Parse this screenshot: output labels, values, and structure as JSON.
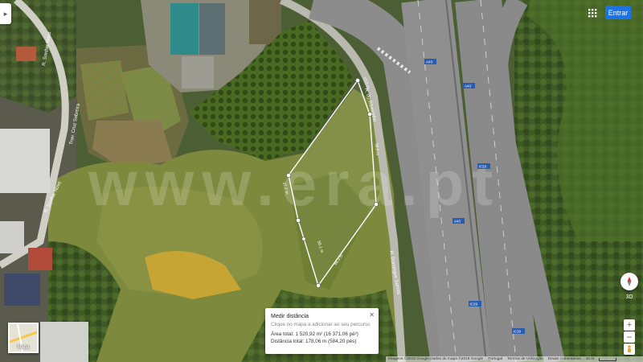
{
  "map": {
    "watermark": "www.era.pt",
    "road_labels": [
      "R. Sonhar Novo",
      "Trav. Cruz Sobreira",
      "R. Sonhar Novo",
      "R. do Ribeirinho",
      "R. Domingos Santos"
    ],
    "segment_labels": [
      "10,0 m",
      "38,5 m",
      "46,3 m",
      "56,1 m",
      "27,7 m"
    ],
    "highway_shields": [
      "A43",
      "A43",
      "IC29",
      "A43",
      "IC29",
      "IC29"
    ]
  },
  "header": {
    "collapse_icon": "chevron-right-icon",
    "apps_icon": "apps-grid-icon",
    "signin_label": "Entrar",
    "accent_color": "#1a73e8"
  },
  "measure_card": {
    "title": "Medir distância",
    "hint": "Clique no mapa a adicionar ao seu percurso",
    "area": "Área total: 1 520,92 m² (16 371,06 pé²)",
    "distance": "Distância total: 178,06 m (584,20 pés)",
    "close_icon": "close-icon"
  },
  "layer_switcher": {
    "label": "Mapa"
  },
  "controls": {
    "tilt_label": "3D",
    "zoom_in": "+",
    "zoom_out": "−"
  },
  "footer": {
    "copyright": "Imagens ©2019 Google,Dados do mapa ©2019 Google",
    "country": "Portugal",
    "terms": "Termos de Utilização",
    "feedback": "Enviar comentários",
    "scale": "10 m"
  }
}
